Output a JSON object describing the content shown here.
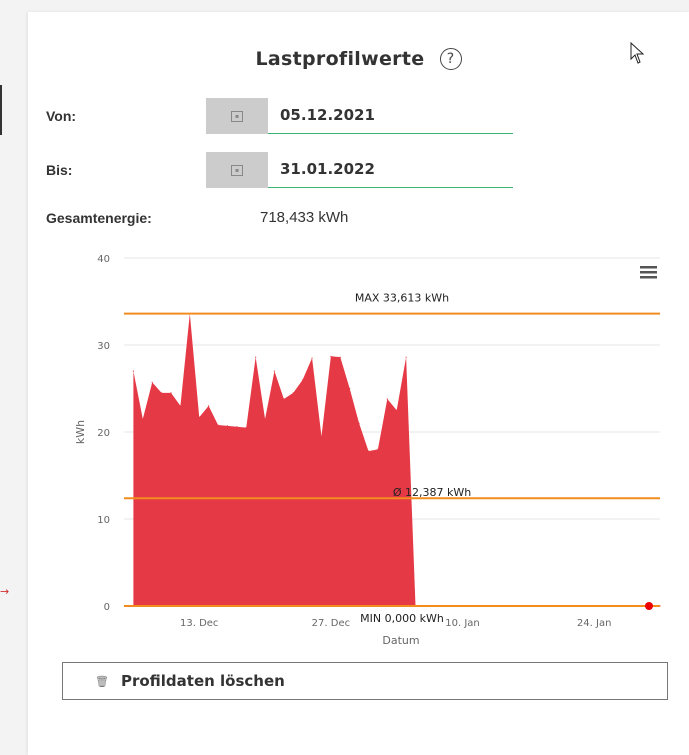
{
  "panel": {
    "title": "Lastprofilwerte",
    "help_glyph": "?",
    "from_label": "Von:",
    "from_value": "05.12.2021",
    "to_label": "Bis:",
    "to_value": "31.01.2022",
    "total_label": "Gesamtenergie:",
    "total_value": "718,433 kWh",
    "delete_label": "Profildaten löschen"
  },
  "icons": {
    "calendar": "calendar-icon",
    "help": "help-circle-icon",
    "menu": "hamburger-menu-icon",
    "trash": "trash-icon",
    "cursor": "mouse-cursor-icon"
  },
  "colors": {
    "area": "#e63946",
    "lines": "#f28c1e",
    "accent_underline": "#3cb371"
  },
  "chart_data": {
    "type": "area",
    "xlabel": "Datum",
    "ylabel": "kWh",
    "ylim": [
      0,
      40
    ],
    "yticks": [
      "0",
      "10",
      "20",
      "30",
      "40"
    ],
    "x_start": "2021-12-05",
    "x_end": "2022-01-31",
    "xticks": [
      {
        "date": "2021-12-13",
        "label": "13. Dec"
      },
      {
        "date": "2021-12-27",
        "label": "27. Dec"
      },
      {
        "date": "2022-01-10",
        "label": "10. Jan"
      },
      {
        "date": "2022-01-24",
        "label": "24. Jan"
      }
    ],
    "series": [
      {
        "values": [
          [
            "2021-12-06",
            27
          ],
          [
            "2021-12-07",
            21.5
          ],
          [
            "2021-12-08",
            25.7
          ],
          [
            "2021-12-09",
            24.5
          ],
          [
            "2021-12-10",
            24.5
          ],
          [
            "2021-12-11",
            23
          ],
          [
            "2021-12-12",
            33.6
          ],
          [
            "2021-12-13",
            21.7
          ],
          [
            "2021-12-14",
            23
          ],
          [
            "2021-12-15",
            20.8
          ],
          [
            "2021-12-16",
            20.7
          ],
          [
            "2021-12-17",
            20.6
          ],
          [
            "2021-12-18",
            20.5
          ],
          [
            "2021-12-19",
            28.6
          ],
          [
            "2021-12-20",
            21.5
          ],
          [
            "2021-12-21",
            27
          ],
          [
            "2021-12-22",
            23.8
          ],
          [
            "2021-12-23",
            24.5
          ],
          [
            "2021-12-24",
            26
          ],
          [
            "2021-12-25",
            28.5
          ],
          [
            "2021-12-26",
            19.5
          ],
          [
            "2021-12-27",
            28.7
          ],
          [
            "2021-12-28",
            28.6
          ],
          [
            "2021-12-29",
            25
          ],
          [
            "2021-12-30",
            21
          ],
          [
            "2021-12-31",
            17.8
          ],
          [
            "2022-01-01",
            18
          ],
          [
            "2022-01-02",
            23.8
          ],
          [
            "2022-01-03",
            22.5
          ],
          [
            "2022-01-04",
            28.6
          ],
          [
            "2022-01-05",
            0
          ],
          [
            "2022-01-31",
            0
          ]
        ]
      }
    ],
    "reference_lines": [
      {
        "label": "MAX 33,613 kWh",
        "value": 33.613
      },
      {
        "label": "Ø 12,387 kWh",
        "value": 12.387
      },
      {
        "label": "MIN 0,000 kWh",
        "value": 0
      }
    ],
    "grid": true
  }
}
